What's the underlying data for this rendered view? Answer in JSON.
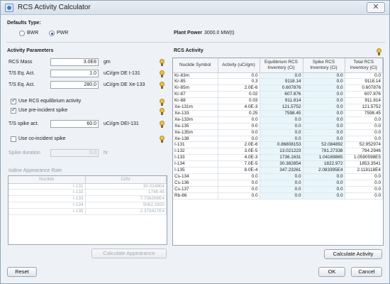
{
  "window": {
    "title": "RCS Activity Calculator",
    "close_glyph": "✕"
  },
  "defaults": {
    "title": "Defaults Type:",
    "options": [
      {
        "label": "BWR",
        "selected": false
      },
      {
        "label": "PWR",
        "selected": true
      }
    ],
    "plant_power_label": "Plant Power",
    "plant_power_value": "3000.0 MW(t)"
  },
  "params": {
    "title": "Activity Parameters",
    "rcs_mass": {
      "label": "RCS Mass",
      "value": "3.0E8",
      "unit": "gm"
    },
    "ts_eq_act_1": {
      "label": "T/S Eq. Act.",
      "value": "1.0",
      "unit": "uCi/gm DE I-131"
    },
    "ts_eq_act_2": {
      "label": "T/S Eq. Act.",
      "value": "280.0",
      "unit": "uCi/gm DE Xe-133"
    },
    "use_rcs_eq": {
      "label": "Use RCS equilibrium activity",
      "checked": true
    },
    "use_pre_spike": {
      "label": "Use pre-incident spike",
      "checked": true
    },
    "ts_spike_act": {
      "label": "T/S spike act.",
      "value": "60.0",
      "unit": "uCi/gm DEI-131"
    },
    "use_co_spike": {
      "label": "Use co-incident spike",
      "checked": false
    },
    "spike_duration": {
      "label": "Spike duration",
      "value": "0.0",
      "unit": "hr"
    }
  },
  "iodine": {
    "title": "Iodine Appearance Rate",
    "columns": [
      "Nuclide",
      "Ci/hr"
    ],
    "rows": [
      [
        "I-131",
        "30.024904"
      ],
      [
        "I-132",
        "1748.45"
      ],
      [
        "I-133",
        "7.736266E4"
      ],
      [
        "I-134",
        "9062.2820"
      ],
      [
        "I-135",
        "2.379427E4"
      ]
    ],
    "button": "Calculate Appearance"
  },
  "rcs": {
    "title": "RCS Activity",
    "columns": [
      "Nuclide Symbol",
      "Activity (uCi/gm)",
      "Equilibrium RCS Inventory (Ci)",
      "Spike RCS Inventory (Ci)",
      "Total RCS Inventory (Ci)"
    ],
    "rows": [
      [
        "Kr-83m",
        "0.0",
        "0.0",
        "0.0",
        "0.0"
      ],
      [
        "Kr-85",
        "0.3",
        "9118.14",
        "0.0",
        "9118.14"
      ],
      [
        "Kr-85m",
        "2.0E-6",
        "0.607876",
        "0.0",
        "0.607876"
      ],
      [
        "Kr-87",
        "0.02",
        "607.876",
        "0.0",
        "607.876"
      ],
      [
        "Kr-88",
        "0.03",
        "911.814",
        "0.0",
        "911.814"
      ],
      [
        "Xe-131m",
        "4.0E-3",
        "121.5752",
        "0.0",
        "121.5752"
      ],
      [
        "Xe-133",
        "0.25",
        "7598.45",
        "0.0",
        "7598.45"
      ],
      [
        "Xe-133m",
        "0.0",
        "0.0",
        "0.0",
        "0.0"
      ],
      [
        "Xe-135",
        "0.0",
        "0.0",
        "0.0",
        "0.0"
      ],
      [
        "Xe-135m",
        "0.0",
        "0.0",
        "0.0",
        "0.0"
      ],
      [
        "Xe-138",
        "0.0",
        "0.0",
        "0.0",
        "0.0"
      ],
      [
        "I-131",
        "2.0E-6",
        "0.86808153",
        "52.084892",
        "52.952974"
      ],
      [
        "I-132",
        "3.0E-5",
        "13.021223",
        "781.27338",
        "794.2946"
      ],
      [
        "I-133",
        "4.0E-3",
        "1736.1631",
        "1.04169865",
        "1.0590598E5"
      ],
      [
        "I-134",
        "7.0E-5",
        "30.382854",
        "1822.972",
        "1853.3541"
      ],
      [
        "I-135",
        "8.0E-4",
        "347.23261",
        "2.083395E4",
        "2.118118E4"
      ],
      [
        "Cs-134",
        "0.0",
        "0.0",
        "0.0",
        "0.0"
      ],
      [
        "Cs-136",
        "0.0",
        "0.0",
        "0.0",
        "0.0"
      ],
      [
        "Cs-137",
        "0.0",
        "0.0",
        "0.0",
        "0.0"
      ],
      [
        "Rb-86",
        "0.0",
        "0.0",
        "0.0",
        "0.0"
      ]
    ],
    "button": "Calculate Activity"
  },
  "footer": {
    "reset": "Reset",
    "ok": "OK",
    "cancel": "Cancel"
  }
}
